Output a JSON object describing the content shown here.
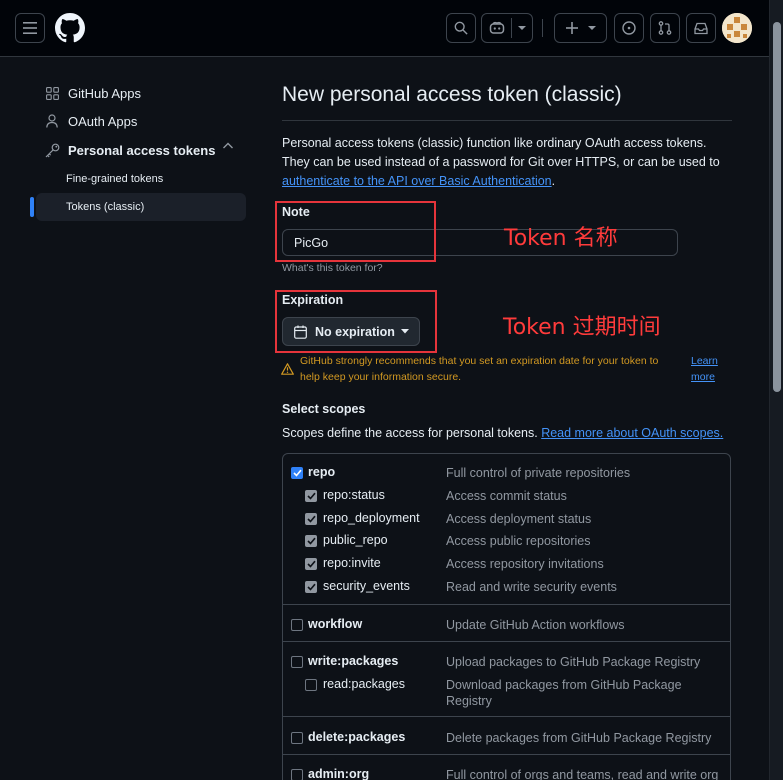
{
  "sidebar": {
    "items": [
      {
        "label": "GitHub Apps",
        "icon": "apps-grid-icon"
      },
      {
        "label": "OAuth Apps",
        "icon": "person-icon"
      },
      {
        "label": "Personal access tokens",
        "icon": "key-icon"
      }
    ],
    "sub_items": [
      {
        "label": "Fine-grained tokens"
      },
      {
        "label": "Tokens (classic)"
      }
    ]
  },
  "main": {
    "title": "New personal access token (classic)",
    "description": "Personal access tokens (classic) function like ordinary OAuth access tokens. They can be used instead of a password for Git over HTTPS, or can be used to",
    "description_link": "authenticate to the API over Basic Authentication",
    "description_end": ".",
    "note_label": "Note",
    "note_value": "PicGo",
    "note_hint": "What's this token for?",
    "expiration_label": "Expiration",
    "expiration_value": "No expiration",
    "warning_text": "GitHub strongly recommends that you set an expiration date for your token to help keep your information secure.",
    "warning_link": "Learn more",
    "scopes_title": "Select scopes",
    "scopes_desc": "Scopes define the access for personal tokens.",
    "scopes_link": "Read more about OAuth scopes."
  },
  "annotations": {
    "note": "Token 名称",
    "expiration": "Token 过期时间"
  },
  "scopes": {
    "repo": {
      "name": "repo",
      "desc": "Full control of private repositories",
      "checked": true
    },
    "repo_status": {
      "name": "repo:status",
      "desc": "Access commit status"
    },
    "repo_deployment": {
      "name": "repo_deployment",
      "desc": "Access deployment status"
    },
    "public_repo": {
      "name": "public_repo",
      "desc": "Access public repositories"
    },
    "repo_invite": {
      "name": "repo:invite",
      "desc": "Access repository invitations"
    },
    "security_events": {
      "name": "security_events",
      "desc": "Read and write security events"
    },
    "workflow": {
      "name": "workflow",
      "desc": "Update GitHub Action workflows"
    },
    "write_packages": {
      "name": "write:packages",
      "desc": "Upload packages to GitHub Package Registry"
    },
    "read_packages": {
      "name": "read:packages",
      "desc": "Download packages from GitHub Package Registry"
    },
    "delete_packages": {
      "name": "delete:packages",
      "desc": "Delete packages from GitHub Package Registry"
    },
    "admin_org": {
      "name": "admin:org",
      "desc": "Full control of orgs and teams, read and write org"
    }
  },
  "colors": {
    "background": "#0d1117",
    "accent": "#2f81f7",
    "link": "#4493f8",
    "warning": "#d29922",
    "annotation": "#ff3b3b"
  }
}
